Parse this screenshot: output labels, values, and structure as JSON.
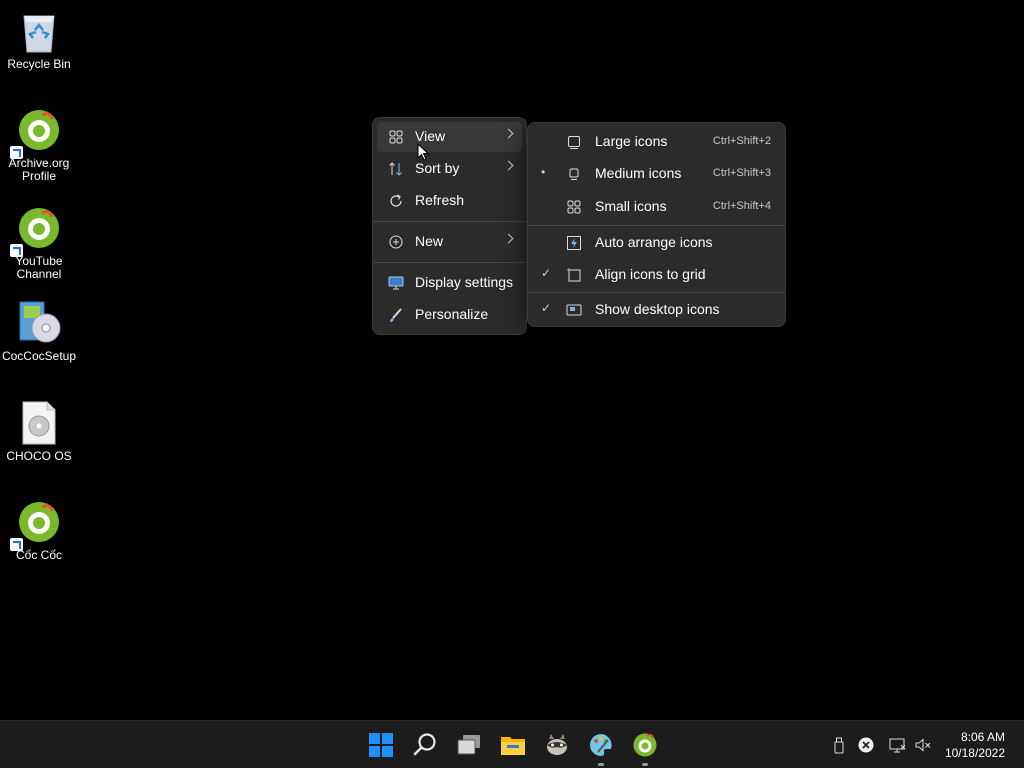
{
  "desktop": {
    "icons": [
      {
        "label": "Recycle Bin"
      },
      {
        "label": "Archive.org Profile"
      },
      {
        "label": "YouTube Channel"
      },
      {
        "label": "CocCocSetup"
      },
      {
        "label": "CHOCO OS"
      },
      {
        "label": "Cốc Cốc"
      }
    ]
  },
  "context_menu": {
    "items": [
      {
        "label": "View",
        "icon": "grid-icon"
      },
      {
        "label": "Sort by",
        "icon": "sort-icon"
      },
      {
        "label": "Refresh",
        "icon": "refresh-icon"
      },
      {
        "label": "New",
        "icon": "plus-circle-icon"
      },
      {
        "label": "Display settings",
        "icon": "display-icon"
      },
      {
        "label": "Personalize",
        "icon": "brush-icon"
      }
    ]
  },
  "view_submenu": {
    "items": [
      {
        "label": "Large icons",
        "shortcut": "Ctrl+Shift+2",
        "mark": ""
      },
      {
        "label": "Medium icons",
        "shortcut": "Ctrl+Shift+3",
        "mark": "•"
      },
      {
        "label": "Small icons",
        "shortcut": "Ctrl+Shift+4",
        "mark": ""
      },
      {
        "label": "Auto arrange icons",
        "shortcut": "",
        "mark": ""
      },
      {
        "label": "Align icons to grid",
        "shortcut": "",
        "mark": "✓"
      },
      {
        "label": "Show desktop icons",
        "shortcut": "",
        "mark": "✓"
      }
    ]
  },
  "taskbar": {
    "apps": [
      "start-icon",
      "search-icon",
      "task-view-icon",
      "file-explorer-icon",
      "raccoon-app-icon",
      "paint-app-icon",
      "coccoc-browser-icon"
    ]
  },
  "clock": {
    "time": "8:06 AM",
    "date": "10/18/2022"
  }
}
